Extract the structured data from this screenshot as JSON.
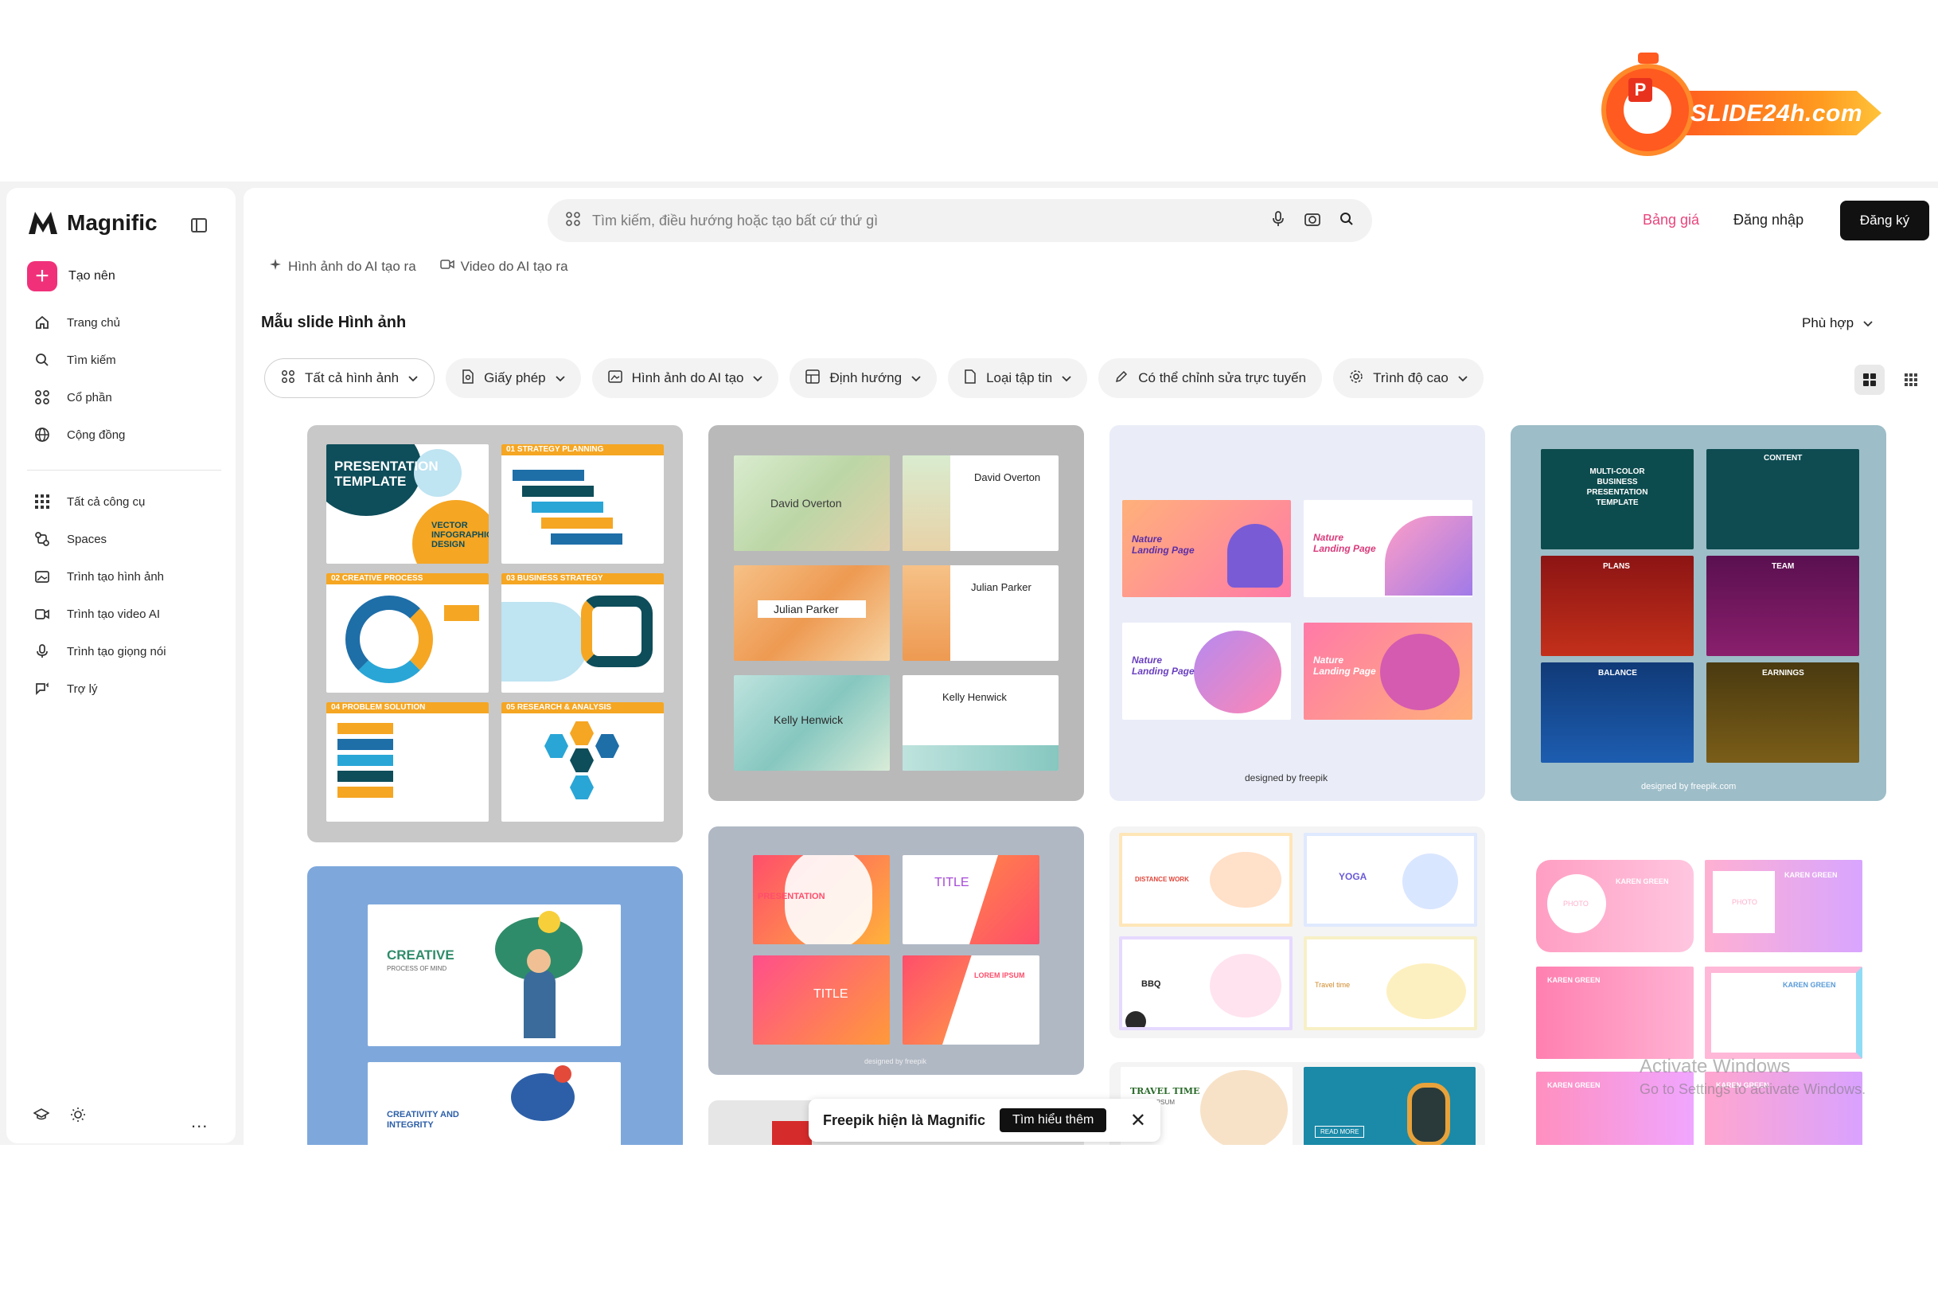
{
  "watermark": {
    "logo_text": "SLIDE24h.com"
  },
  "sidebar": {
    "brand": "Magnific",
    "create_label": "Tạo nên",
    "items": [
      {
        "label": "Trang chủ",
        "icon": "home-icon"
      },
      {
        "label": "Tìm kiếm",
        "icon": "search-icon"
      },
      {
        "label": "Cổ phần",
        "icon": "grid-icon"
      },
      {
        "label": "Cộng đồng",
        "icon": "globe-icon"
      },
      {
        "label": "Tất cả công cụ",
        "icon": "apps-icon"
      },
      {
        "label": "Spaces",
        "icon": "spaces-icon"
      },
      {
        "label": "Trình tạo hình ảnh",
        "icon": "image-icon"
      },
      {
        "label": "Trình tạo video AI",
        "icon": "video-icon"
      },
      {
        "label": "Trình tạo giọng nói",
        "icon": "mic-icon"
      },
      {
        "label": "Trợ lý",
        "icon": "assistant-icon"
      }
    ],
    "more": "..."
  },
  "header": {
    "search_placeholder": "Tìm kiếm, điều hướng hoặc tạo bất cứ thứ gì",
    "pricing": "Bảng giá",
    "login": "Đăng nhập",
    "signup": "Đăng ký"
  },
  "ai_links": [
    "Hình ảnh do AI tạo ra",
    "Video do AI tạo ra"
  ],
  "page_title": "Mẫu slide Hình ảnh",
  "sort_label": "Phù hợp",
  "filters": [
    "Tất cả hình ảnh",
    "Giấy phép",
    "Hình ảnh do AI tạo",
    "Định hướng",
    "Loại tập tin",
    "Có thể chỉnh sửa trực tuyến",
    "Trình độ cao"
  ],
  "cards": {
    "card1": {
      "slide1_title": "PRESENTATION TEMPLATE",
      "slide1_sub": "VECTOR INFOGRAPHIC DESIGN",
      "slide2_title": "01 STRATEGY PLANNING",
      "slide3_title": "02 CREATIVE PROCESS",
      "slide4_title": "03 BUSINESS STRATEGY",
      "slide5_title": "04 PROBLEM SOLUTION",
      "slide6_title": "05 RESEARCH & ANALYSIS"
    },
    "card2": {
      "names": [
        "David Overton",
        "David Overton",
        "Julian Parker",
        "Julian Parker",
        "Kelly Henwick",
        "Kelly Henwick"
      ]
    },
    "card3": {
      "label": "Nature Landing Page",
      "credit": "designed by freepik"
    },
    "card4": {
      "titles": [
        "MULTI-COLOR BUSINESS PRESENTATION TEMPLATE",
        "CONTENT",
        "PLANS",
        "TEAM",
        "BALANCE",
        "EARNINGS"
      ],
      "credit": "designed by freepik.com"
    },
    "card5": {
      "title": "CREATIVE",
      "sub": "PROCESS OF MIND",
      "title2": "CREATIVITY AND INTEGRITY"
    },
    "card6": {
      "titles": [
        "PRESENTATION",
        "TITLE",
        "TITLE",
        "LOREM IPSUM"
      ],
      "credit": "designed by freepik"
    },
    "card7": {
      "labels": [
        "DISTANCE WORK",
        "YOGA",
        "BBQ",
        "Travel time"
      ]
    },
    "card8": {
      "name": "KAREN GREEN",
      "photo": "PHOTO"
    },
    "card9": {
      "title": "TRAVEL TIME",
      "sub": "LOREM IPSUM",
      "btn": "READ MORE"
    }
  },
  "banner": {
    "message": "Freepik hiện là Magnific",
    "learn_more": "Tìm hiểu thêm"
  },
  "windows_notice": {
    "line1": "Activate Windows",
    "line2": "Go to Settings to activate Windows."
  },
  "colors": {
    "accent_pink": "#f0317a",
    "pricing_pink": "#e8457c",
    "signup_bg": "#111111"
  }
}
